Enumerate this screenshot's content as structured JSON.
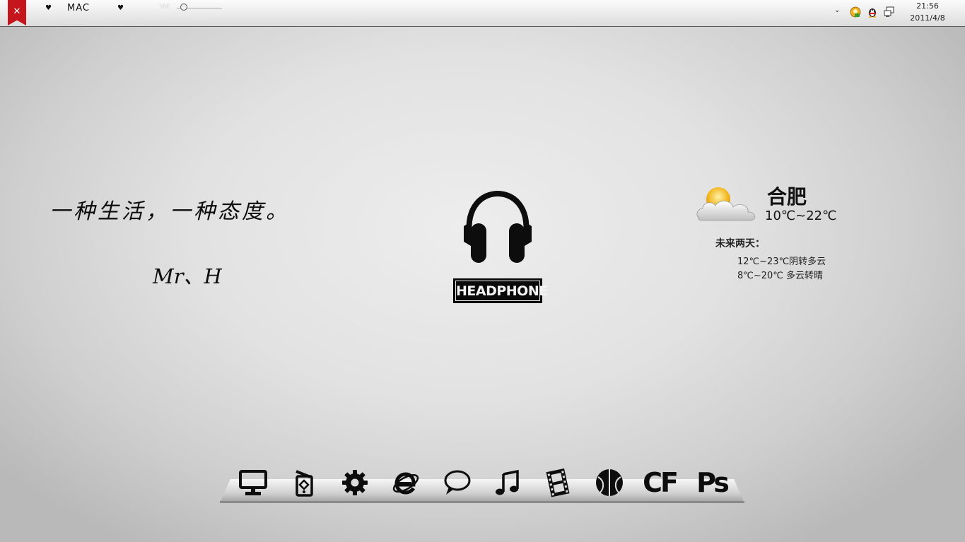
{
  "topbar": {
    "close_glyph": "✕",
    "heart_glyph": "♥",
    "app_label": "MAC",
    "volume_label": "Vol",
    "volume_level": 0.15,
    "tray_chevron": "⌄",
    "tray_icons": [
      "qq-orange-icon",
      "qq-penguin-icon",
      "network-icon"
    ],
    "time": "21:56",
    "date": "2011/4/8"
  },
  "desktop": {
    "quote": "一种生活，一种态度。",
    "signature": "Mr、H"
  },
  "headphone_widget": {
    "icon": "headphone-icon",
    "label": "HEADPHONE"
  },
  "weather": {
    "icon": "partly-cloudy-icon",
    "city": "合肥",
    "temperature": "10℃~22℃",
    "forecast_title": "未来两天：",
    "forecast": [
      "12℃~23℃阴转多云",
      "8℃~20℃ 多云转晴"
    ]
  },
  "dock": {
    "items": [
      {
        "name": "computer-icon"
      },
      {
        "name": "recycle-bin-icon"
      },
      {
        "name": "settings-gear-icon"
      },
      {
        "name": "internet-explorer-icon"
      },
      {
        "name": "chat-bubble-icon"
      },
      {
        "name": "music-note-icon"
      },
      {
        "name": "film-strip-icon"
      },
      {
        "name": "basketball-icon"
      },
      {
        "name": "cf-game-icon",
        "text": "CF"
      },
      {
        "name": "photoshop-icon",
        "text": "Ps"
      }
    ]
  },
  "colors": {
    "flag": "#c4161c",
    "icon": "#0d0d0d"
  }
}
